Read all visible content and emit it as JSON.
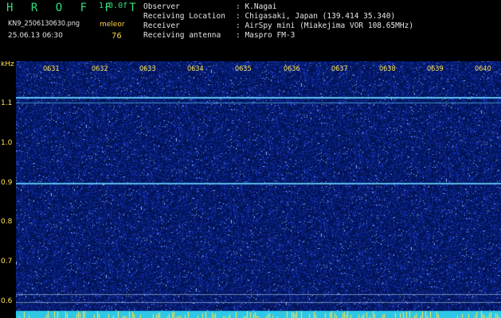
{
  "header": {
    "brand": "H R O F F T",
    "version": "1.0.0f",
    "filename": "KN9_2506130630.png",
    "mode": "meleor",
    "datetime": "25.06.13 06:30",
    "count": "76",
    "observer_label": "Observer",
    "observer_value": ": K.Nagai",
    "location_label": "Receiving Location",
    "location_value": ": Chigasaki, Japan (139.414 35.340)",
    "receiver_label": "Receiver",
    "receiver_value": ": AirSpy mini (Miakejima VOR 108.65MHz)",
    "antenna_label": "Receiving antenna",
    "antenna_value": ": Maspro FM-3"
  },
  "plot": {
    "unit": "kHz",
    "freq_ticks": [
      "1.1",
      "1.0",
      "0.9",
      "0.8",
      "0.7",
      "0.6"
    ],
    "time_ticks": [
      "0631",
      "0632",
      "0633",
      "0634",
      "0635",
      "0636",
      "0637",
      "0638",
      "0639",
      "0640"
    ],
    "colors": {
      "background": "#001a4d",
      "noise": "#1a3cd6",
      "carrier": "#6ad8ff",
      "bottom_strip": "#2ec8e6",
      "spike": "#ffe34d",
      "label": "#ffe34d"
    }
  }
}
